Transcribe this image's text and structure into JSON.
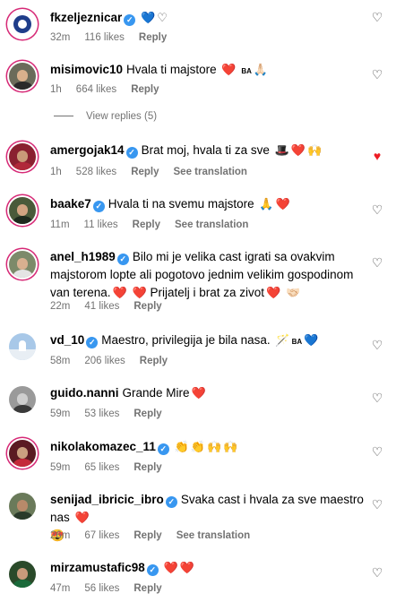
{
  "comments": [
    {
      "username": "fkzeljeznicar",
      "verified": true,
      "text": "",
      "emojis": [
        "💙",
        "♡"
      ],
      "meta": {
        "time": "32m",
        "likes": "116 likes",
        "reply": "Reply",
        "translate": ""
      },
      "liked": false
    },
    {
      "username": "misimovic10",
      "verified": false,
      "text": "Hvala ti majstore",
      "emojis": [
        "❤️",
        "BA",
        "🙏🏻"
      ],
      "meta": {
        "time": "1h",
        "likes": "664 likes",
        "reply": "Reply",
        "translate": ""
      },
      "liked": false
    },
    {
      "username": "amergojak14",
      "verified": true,
      "text": "Brat moj, hvala ti za sve",
      "emojis": [
        "🎩",
        "❤️",
        "🙌"
      ],
      "meta": {
        "time": "1h",
        "likes": "528 likes",
        "reply": "Reply",
        "translate": "See translation"
      },
      "liked": true
    },
    {
      "username": "baake7",
      "verified": true,
      "text": "Hvala ti na svemu majstore",
      "emojis": [
        "🙏",
        "❤️"
      ],
      "meta": {
        "time": "11m",
        "likes": "11 likes",
        "reply": "Reply",
        "translate": "See translation"
      },
      "liked": false
    },
    {
      "username": "anel_h1989",
      "verified": true,
      "text": "Bilo mi je velika cast igrati sa ovakvim majstorom lopte ali pogotovo jednim velikim gospodinom van terena.",
      "text2": "Prijatelj i brat za zivot",
      "emojis": [
        "❤️",
        "❤️"
      ],
      "emojis2": [
        "❤️",
        "🤝🏻"
      ],
      "meta": {
        "time": "22m",
        "likes": "41 likes",
        "reply": "Reply",
        "translate": ""
      },
      "liked": false
    },
    {
      "username": "vd_10",
      "verified": true,
      "text": "Maestro, privilegija je bila nasa.",
      "emojis": [
        "🪄",
        "BA",
        "💙"
      ],
      "meta": {
        "time": "58m",
        "likes": "206 likes",
        "reply": "Reply",
        "translate": ""
      },
      "liked": false
    },
    {
      "username": "guido.nanni",
      "verified": false,
      "text": "Grande Mire",
      "emojis": [
        "❤️"
      ],
      "meta": {
        "time": "59m",
        "likes": "53 likes",
        "reply": "Reply",
        "translate": ""
      },
      "liked": false
    },
    {
      "username": "nikolakomazec_11",
      "verified": true,
      "text": "",
      "emojis": [
        "👏",
        "👏",
        "🙌",
        "🙌"
      ],
      "meta": {
        "time": "59m",
        "likes": "65 likes",
        "reply": "Reply",
        "translate": ""
      },
      "liked": false
    },
    {
      "username": "senijad_ibricic_ibro",
      "verified": true,
      "text": "Svaka cast i hvala za sve maestro nas",
      "emojis": [
        "❤️"
      ],
      "emojis2": [
        "😍"
      ],
      "meta": {
        "time": "26m",
        "likes": "67 likes",
        "reply": "Reply",
        "translate": "See translation"
      },
      "liked": false
    },
    {
      "username": "mirzamustafic98",
      "verified": true,
      "text": "",
      "emojis": [
        "❤️",
        "❤️"
      ],
      "meta": {
        "time": "47m",
        "likes": "56 likes",
        "reply": "Reply",
        "translate": ""
      },
      "liked": false
    }
  ],
  "view_replies": "View replies (5)",
  "colors": {
    "meta_gray": "#737373",
    "verified_blue": "#3897f0",
    "heart_red": "#ed1c24"
  }
}
